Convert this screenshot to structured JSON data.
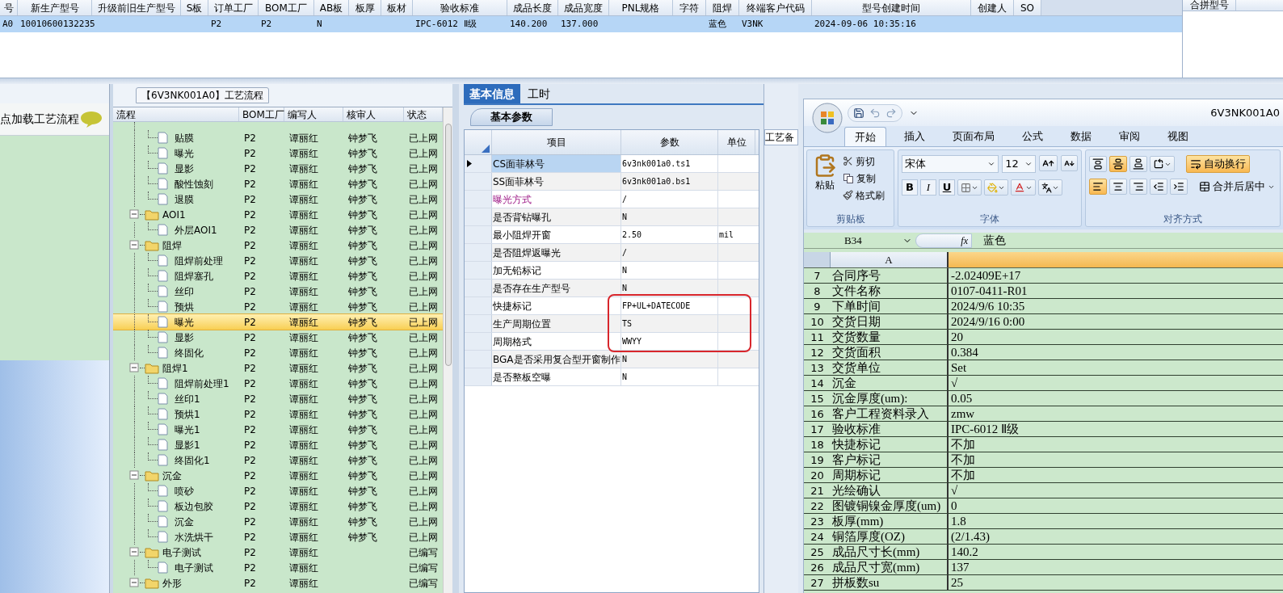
{
  "top_grid": {
    "columns": [
      "号",
      "新生产型号",
      "升级前旧生产型号",
      "S板",
      "订单工厂",
      "BOM工厂",
      "AB板",
      "板厚",
      "板材",
      "验收标准",
      "成品长度",
      "成品宽度",
      "PNL规格",
      "字符",
      "阻焊",
      "终端客户代码",
      "型号创建时间",
      "创建人",
      "SO"
    ],
    "rows": [
      {
        "selected": true,
        "cells": [
          "A0",
          "10010600132235",
          "",
          "",
          "P2",
          "P2",
          "N",
          "",
          "",
          "IPC-6012 Ⅱ级",
          "140.200",
          "137.000",
          "",
          "",
          "蓝色",
          "V3NK",
          "2024-09-06 10:35:16",
          "",
          ""
        ]
      }
    ]
  },
  "side_grid": {
    "columns": [
      "合拼型号"
    ]
  },
  "load_panel": {
    "text": "点加载工艺流程"
  },
  "process_tab": {
    "label": "【6V3NK001A0】工艺流程"
  },
  "tree": {
    "columns": [
      "流程",
      "BOM工厂",
      "编写人",
      "核审人",
      "状态"
    ],
    "orphan_items": [
      {
        "label": "贴膜",
        "bom": "P2",
        "writer": "谭丽红",
        "reviewer": "钟梦飞",
        "status": "已上网",
        "selected": false
      },
      {
        "label": "曝光",
        "bom": "P2",
        "writer": "谭丽红",
        "reviewer": "钟梦飞",
        "status": "已上网",
        "selected": false
      },
      {
        "label": "显影",
        "bom": "P2",
        "writer": "谭丽红",
        "reviewer": "钟梦飞",
        "status": "已上网",
        "selected": false
      },
      {
        "label": "酸性蚀刻",
        "bom": "P2",
        "writer": "谭丽红",
        "reviewer": "钟梦飞",
        "status": "已上网",
        "selected": false
      },
      {
        "label": "退膜",
        "bom": "P2",
        "writer": "谭丽红",
        "reviewer": "钟梦飞",
        "status": "已上网",
        "selected": false
      }
    ],
    "folders": [
      {
        "label": "AOI1",
        "bom": "P2",
        "writer": "谭丽红",
        "reviewer": "钟梦飞",
        "status": "已上网",
        "selected": false,
        "expanded": true,
        "children": [
          {
            "label": "外层AOI1",
            "bom": "P2",
            "writer": "谭丽红",
            "reviewer": "钟梦飞",
            "status": "已上网",
            "selected": false
          }
        ]
      },
      {
        "label": "阻焊",
        "bom": "P2",
        "writer": "谭丽红",
        "reviewer": "钟梦飞",
        "status": "已上网",
        "selected": false,
        "expanded": true,
        "children": [
          {
            "label": "阻焊前处理",
            "bom": "P2",
            "writer": "谭丽红",
            "reviewer": "钟梦飞",
            "status": "已上网",
            "selected": false
          },
          {
            "label": "阻焊塞孔",
            "bom": "P2",
            "writer": "谭丽红",
            "reviewer": "钟梦飞",
            "status": "已上网",
            "selected": false
          },
          {
            "label": "丝印",
            "bom": "P2",
            "writer": "谭丽红",
            "reviewer": "钟梦飞",
            "status": "已上网",
            "selected": false
          },
          {
            "label": "预烘",
            "bom": "P2",
            "writer": "谭丽红",
            "reviewer": "钟梦飞",
            "status": "已上网",
            "selected": false
          },
          {
            "label": "曝光",
            "bom": "P2",
            "writer": "谭丽红",
            "reviewer": "钟梦飞",
            "status": "已上网",
            "selected": true
          },
          {
            "label": "显影",
            "bom": "P2",
            "writer": "谭丽红",
            "reviewer": "钟梦飞",
            "status": "已上网",
            "selected": false
          },
          {
            "label": "终固化",
            "bom": "P2",
            "writer": "谭丽红",
            "reviewer": "钟梦飞",
            "status": "已上网",
            "selected": false
          }
        ]
      },
      {
        "label": "阻焊1",
        "bom": "P2",
        "writer": "谭丽红",
        "reviewer": "钟梦飞",
        "status": "已上网",
        "selected": false,
        "expanded": true,
        "children": [
          {
            "label": "阻焊前处理1",
            "bom": "P2",
            "writer": "谭丽红",
            "reviewer": "钟梦飞",
            "status": "已上网",
            "selected": false
          },
          {
            "label": "丝印1",
            "bom": "P2",
            "writer": "谭丽红",
            "reviewer": "钟梦飞",
            "status": "已上网",
            "selected": false
          },
          {
            "label": "预烘1",
            "bom": "P2",
            "writer": "谭丽红",
            "reviewer": "钟梦飞",
            "status": "已上网",
            "selected": false
          },
          {
            "label": "曝光1",
            "bom": "P2",
            "writer": "谭丽红",
            "reviewer": "钟梦飞",
            "status": "已上网",
            "selected": false
          },
          {
            "label": "显影1",
            "bom": "P2",
            "writer": "谭丽红",
            "reviewer": "钟梦飞",
            "status": "已上网",
            "selected": false
          },
          {
            "label": "终固化1",
            "bom": "P2",
            "writer": "谭丽红",
            "reviewer": "钟梦飞",
            "status": "已上网",
            "selected": false
          }
        ]
      },
      {
        "label": "沉金",
        "bom": "P2",
        "writer": "谭丽红",
        "reviewer": "钟梦飞",
        "status": "已上网",
        "selected": false,
        "expanded": true,
        "children": [
          {
            "label": "喷砂",
            "bom": "P2",
            "writer": "谭丽红",
            "reviewer": "钟梦飞",
            "status": "已上网",
            "selected": false
          },
          {
            "label": "板边包胶",
            "bom": "P2",
            "writer": "谭丽红",
            "reviewer": "钟梦飞",
            "status": "已上网",
            "selected": false
          },
          {
            "label": "沉金",
            "bom": "P2",
            "writer": "谭丽红",
            "reviewer": "钟梦飞",
            "status": "已上网",
            "selected": false
          },
          {
            "label": "水洗烘干",
            "bom": "P2",
            "writer": "谭丽红",
            "reviewer": "钟梦飞",
            "status": "已上网",
            "selected": false
          }
        ]
      },
      {
        "label": "电子测试",
        "bom": "P2",
        "writer": "谭丽红",
        "status": "已编写",
        "selected": false,
        "expanded": true,
        "children": [
          {
            "label": "电子测试",
            "bom": "P2",
            "writer": "谭丽红",
            "status": "已编写",
            "selected": false
          }
        ]
      },
      {
        "label": "外形",
        "bom": "P2",
        "writer": "谭丽红",
        "status": "已编写",
        "selected": false,
        "expanded": true
      }
    ]
  },
  "info_tabs": [
    {
      "label": "基本信息",
      "selected": true
    },
    {
      "label": "工时",
      "selected": false
    }
  ],
  "param_tab": {
    "label": "基本参数"
  },
  "side_tab": {
    "label": "工艺备"
  },
  "params": {
    "columns": [
      "项目",
      "参数",
      "单位"
    ],
    "rows": [
      {
        "item": "CS面菲林号",
        "value": "6v3nk001a0.ts1",
        "current": true,
        "accent": false
      },
      {
        "item": "SS面菲林号",
        "value": "6v3nk001a0.bs1",
        "current": false,
        "accent": false
      },
      {
        "item": "曝光方式",
        "value": "/",
        "current": false,
        "accent": true
      },
      {
        "item": "是否背钻曝孔",
        "value": "N",
        "current": false,
        "accent": false
      },
      {
        "item": "最小阻焊开窗",
        "value": "2.50",
        "unit": "mil",
        "current": false,
        "accent": false
      },
      {
        "item": "是否阻焊返曝光",
        "value": "/",
        "current": false,
        "accent": false
      },
      {
        "item": "加无铅标记",
        "value": "N",
        "current": false,
        "accent": false
      },
      {
        "item": "是否存在生产型号",
        "value": "N",
        "current": false,
        "accent": false
      },
      {
        "item": "快捷标记",
        "value": "FP+UL+DATECODE",
        "current": false,
        "accent": false
      },
      {
        "item": "生产周期位置",
        "value": "TS",
        "current": false,
        "accent": false
      },
      {
        "item": "周期格式",
        "value": "WWYY",
        "current": false,
        "accent": false
      },
      {
        "item": "BGA是否采用复合型开窗制作",
        "value": "N",
        "current": false,
        "accent": false
      },
      {
        "item": "是否整板空曝",
        "value": "N",
        "current": false,
        "accent": false
      }
    ]
  },
  "excel": {
    "title": "6V3NK001A0",
    "tabs": [
      {
        "label": "开始",
        "selected": true
      },
      {
        "label": "插入",
        "selected": false
      },
      {
        "label": "页面布局",
        "selected": false
      },
      {
        "label": "公式",
        "selected": false
      },
      {
        "label": "数据",
        "selected": false
      },
      {
        "label": "审阅",
        "selected": false
      },
      {
        "label": "视图",
        "selected": false
      }
    ],
    "clipboard": {
      "title": "剪贴板",
      "paste": "粘贴",
      "items": [
        "剪切",
        "复制",
        "格式刷"
      ]
    },
    "font": {
      "title": "字体",
      "name": "宋体",
      "size": "12",
      "bold": "B",
      "italic": "I",
      "underline": "U"
    },
    "alignment": {
      "title": "对齐方式",
      "wrap": {
        "label": "自动换行",
        "selected": true
      },
      "merge": "合并后居中",
      "vertical": [
        {
          "selected": false
        },
        {
          "selected": true
        },
        {
          "selected": false
        }
      ],
      "horizontal": [
        {
          "selected": true
        },
        {
          "selected": false
        },
        {
          "selected": false
        }
      ]
    },
    "name_box": "B34",
    "fx": "fx",
    "formula": "蓝色",
    "column_a": "A",
    "rows": [
      [
        "7",
        "合同序号",
        "-2.02409E+17"
      ],
      [
        "8",
        "文件名称",
        "0107-0411-R01"
      ],
      [
        "9",
        "下单时间",
        "2024/9/6 10:35"
      ],
      [
        "10",
        "交货日期",
        "2024/9/16 0:00"
      ],
      [
        "11",
        "交货数量",
        "20"
      ],
      [
        "12",
        "交货面积",
        "0.384"
      ],
      [
        "13",
        "交货单位",
        "Set"
      ],
      [
        "14",
        "沉金",
        "√"
      ],
      [
        "15",
        "沉金厚度(um):",
        "0.05"
      ],
      [
        "16",
        "客户工程资料录入",
        "zmw"
      ],
      [
        "17",
        "验收标准",
        "IPC-6012 Ⅱ级"
      ],
      [
        "18",
        "快捷标记",
        "不加"
      ],
      [
        "19",
        "客户标记",
        "不加"
      ],
      [
        "20",
        "周期标记",
        "不加"
      ],
      [
        "21",
        "光绘确认",
        "√"
      ],
      [
        "22",
        "图镀铜镍金厚度(um)",
        "0"
      ],
      [
        "23",
        "板厚(mm)",
        "1.8"
      ],
      [
        "24",
        "铜箔厚度(OZ)",
        "(2/1.43)"
      ],
      [
        "25",
        "成品尺寸长(mm)",
        "140.2"
      ],
      [
        "26",
        "成品尺寸宽(mm)",
        "137"
      ],
      [
        "27",
        "拼板数su",
        "25"
      ]
    ]
  }
}
